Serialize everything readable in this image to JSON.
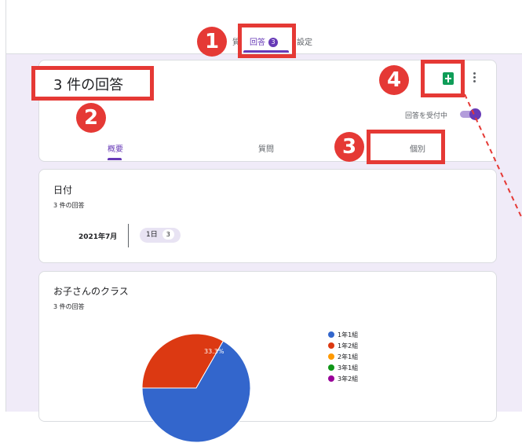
{
  "top_tabs": {
    "questions_partial": "質",
    "responses": "回答",
    "responses_count": "3",
    "settings": "設定"
  },
  "summary": {
    "title": "3 件の回答",
    "accepting_label": "回答を受付中",
    "accepting_on": true,
    "subtabs": [
      "概要",
      "質問",
      "個別"
    ],
    "active_subtab": "概要"
  },
  "questions": [
    {
      "title": "日付",
      "count": "3 件の回答",
      "month": "2021年7月",
      "day": "1日",
      "day_count": "3"
    },
    {
      "title": "お子さんのクラス",
      "count": "3 件の回答",
      "pie_label": "33.3%",
      "legend": [
        {
          "label": "1年1組",
          "color": "#3366cc"
        },
        {
          "label": "1年2組",
          "color": "#dc3912"
        },
        {
          "label": "2年1組",
          "color": "#ff9900"
        },
        {
          "label": "3年1組",
          "color": "#109618"
        },
        {
          "label": "3年2組",
          "color": "#990099"
        }
      ]
    }
  ],
  "chart_data": {
    "type": "pie",
    "categories": [
      "1年1組",
      "1年2組",
      "2年1組",
      "3年1組",
      "3年2組"
    ],
    "values": [
      66.7,
      33.3,
      0,
      0,
      0
    ]
  },
  "annotations": {
    "numbers": [
      "1",
      "2",
      "3",
      "4"
    ],
    "accent_color": "#e53935"
  },
  "colors": {
    "brand": "#673ab7",
    "background": "#f0ebf8",
    "sheets_green": "#0f9d58"
  }
}
